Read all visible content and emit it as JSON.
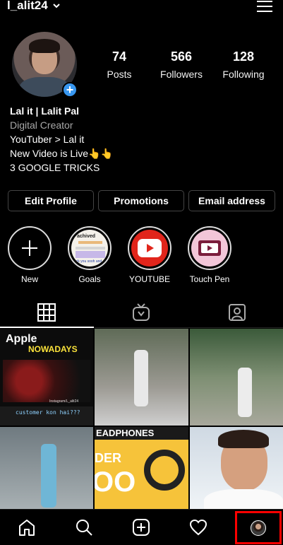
{
  "header": {
    "username": "l_alit24"
  },
  "stats": [
    {
      "value": "74",
      "label": "Posts"
    },
    {
      "value": "566",
      "label": "Followers"
    },
    {
      "value": "128",
      "label": "Following"
    }
  ],
  "bio": {
    "name": "Lal it | Lalit Pal",
    "category": "Digital Creator",
    "lines": [
      "YouTuber > Lal it",
      "New Video is Live👆👆",
      "3 GOOGLE TRICKS"
    ]
  },
  "buttons": {
    "edit_profile": "Edit Profile",
    "promotions": "Promotions",
    "email": "Email address"
  },
  "highlights": [
    {
      "label": "New"
    },
    {
      "label": "Goals",
      "cover_text_top": "achived",
      "cover_text_bottom": "..ck you sooh and"
    },
    {
      "label": "YOUTUBE"
    },
    {
      "label": "Touch Pen"
    }
  ],
  "posts": {
    "post1_title": "Apple",
    "post1_subtitle": "NOWADAYS",
    "post1_credit": "Instagram/L_alit24",
    "post1_caption": "customer kon hai???",
    "post5_title": "EADPHONES",
    "post5_left": "DER",
    "post5_big": "OO"
  },
  "colors": {
    "accent_blue": "#3897f0",
    "youtube_red": "#e1251b",
    "highlight_red_border": "#ff0000"
  }
}
